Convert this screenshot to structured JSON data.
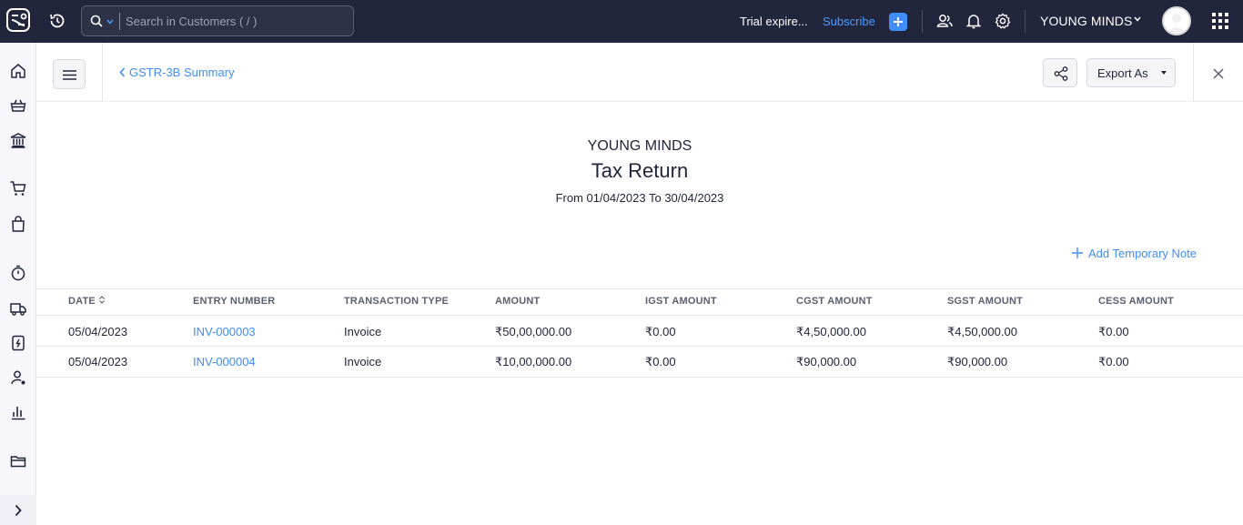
{
  "topbar": {
    "search_placeholder": "Search in Customers ( / )",
    "trial_text": "Trial expire...",
    "subscribe_label": "Subscribe",
    "org_name": "YOUNG MINDS"
  },
  "header": {
    "breadcrumb": "GSTR-3B Summary",
    "export_label": "Export As"
  },
  "report": {
    "org_name": "YOUNG MINDS",
    "title": "Tax Return",
    "date_range": "From 01/04/2023 To 30/04/2023",
    "add_note_label": "Add Temporary Note"
  },
  "table": {
    "columns": [
      "DATE",
      "ENTRY NUMBER",
      "TRANSACTION TYPE",
      "AMOUNT",
      "IGST AMOUNT",
      "CGST AMOUNT",
      "SGST AMOUNT",
      "CESS AMOUNT"
    ],
    "rows": [
      [
        "05/04/2023",
        "INV-000003",
        "Invoice",
        "₹50,00,000.00",
        "₹0.00",
        "₹4,50,000.00",
        "₹4,50,000.00",
        "₹0.00"
      ],
      [
        "05/04/2023",
        "INV-000004",
        "Invoice",
        "₹10,00,000.00",
        "₹0.00",
        "₹90,000.00",
        "₹90,000.00",
        "₹0.00"
      ]
    ]
  },
  "colors": {
    "topbar_bg": "#21263c",
    "accent": "#408dfb"
  }
}
